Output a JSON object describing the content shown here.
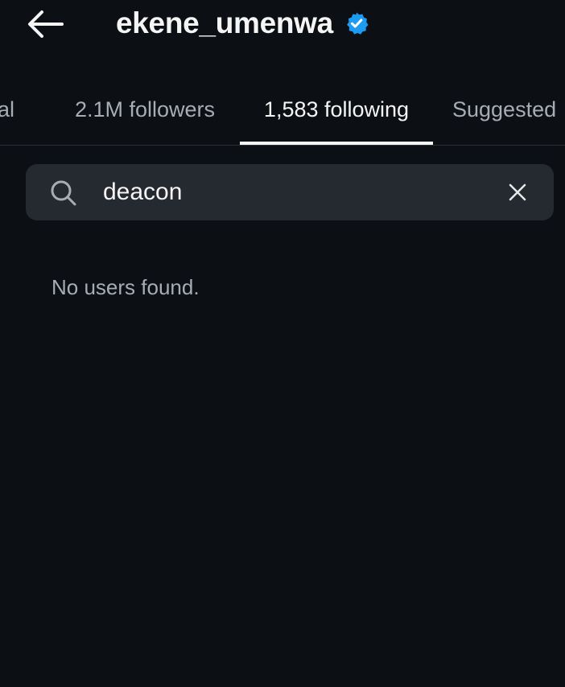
{
  "header": {
    "username": "ekene_umenwa",
    "back_icon": "arrow-left-icon",
    "verified_icon": "verified-badge-icon",
    "verified_color": "#1d9bf0"
  },
  "tabs": [
    {
      "label": "ual",
      "active": false
    },
    {
      "label": "2.1M followers",
      "active": false
    },
    {
      "label": "1,583 following",
      "active": true
    },
    {
      "label": "Suggested",
      "active": false
    }
  ],
  "search": {
    "value": "deacon",
    "search_icon": "search-icon",
    "clear_icon": "close-icon"
  },
  "results": {
    "empty_message": "No users found."
  },
  "colors": {
    "background": "#0c0f14",
    "search_background": "#252930",
    "primary_text": "#f5f5f5",
    "secondary_text": "#a8acb3"
  }
}
